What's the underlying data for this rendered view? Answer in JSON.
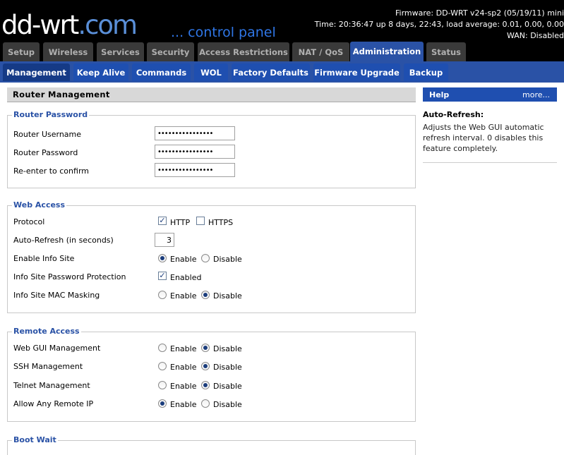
{
  "header": {
    "logo_main": "dd-wrt",
    "logo_dot": ".com",
    "tagline": "... control panel",
    "firmware": "Firmware: DD-WRT v24-sp2 (05/19/11) mini",
    "time": "Time: 20:36:47 up 8 days, 22:43, load average: 0.01, 0.00, 0.00",
    "wan": "WAN: Disabled"
  },
  "main_tabs": [
    {
      "label": "Setup"
    },
    {
      "label": "Wireless"
    },
    {
      "label": "Services"
    },
    {
      "label": "Security"
    },
    {
      "label": "Access Restrictions"
    },
    {
      "label": "NAT / QoS"
    },
    {
      "label": "Administration",
      "active": true
    },
    {
      "label": "Status"
    }
  ],
  "sub_tabs": [
    {
      "label": "Management",
      "active": true
    },
    {
      "label": "Keep Alive"
    },
    {
      "label": "Commands"
    },
    {
      "label": "WOL"
    },
    {
      "label": "Factory Defaults"
    },
    {
      "label": "Firmware Upgrade"
    },
    {
      "label": "Backup"
    }
  ],
  "page_title": "Router Management",
  "router_password": {
    "legend": "Router Password",
    "username_label": "Router Username",
    "password_label": "Router Password",
    "confirm_label": "Re-enter to confirm",
    "username_value": "••••••••••••••••",
    "password_value": "••••••••••••••••",
    "confirm_value": "••••••••••••••••"
  },
  "web_access": {
    "legend": "Web Access",
    "protocol_label": "Protocol",
    "http_label": "HTTP",
    "http_checked": true,
    "https_label": "HTTPS",
    "https_checked": false,
    "auto_refresh_label": "Auto-Refresh (in seconds)",
    "auto_refresh_value": "3",
    "info_site_label": "Enable Info Site",
    "info_site_value": "Enable",
    "info_pw_label": "Info Site Password Protection",
    "info_pw_option": "Enabled",
    "info_pw_checked": true,
    "mac_mask_label": "Info Site MAC Masking",
    "mac_mask_value": "Disable"
  },
  "remote_access": {
    "legend": "Remote Access",
    "webgui_label": "Web GUI Management",
    "webgui_value": "Disable",
    "ssh_label": "SSH Management",
    "ssh_value": "Disable",
    "telnet_label": "Telnet Management",
    "telnet_value": "Disable",
    "anyip_label": "Allow Any Remote IP",
    "anyip_value": "Enable"
  },
  "boot_wait": {
    "legend": "Boot Wait"
  },
  "options": {
    "enable": "Enable",
    "disable": "Disable"
  },
  "help": {
    "title": "Help",
    "more": "more...",
    "heading": "Auto-Refresh:",
    "text": "Adjusts the Web GUI automatic refresh interval. 0 disables this feature completely."
  }
}
